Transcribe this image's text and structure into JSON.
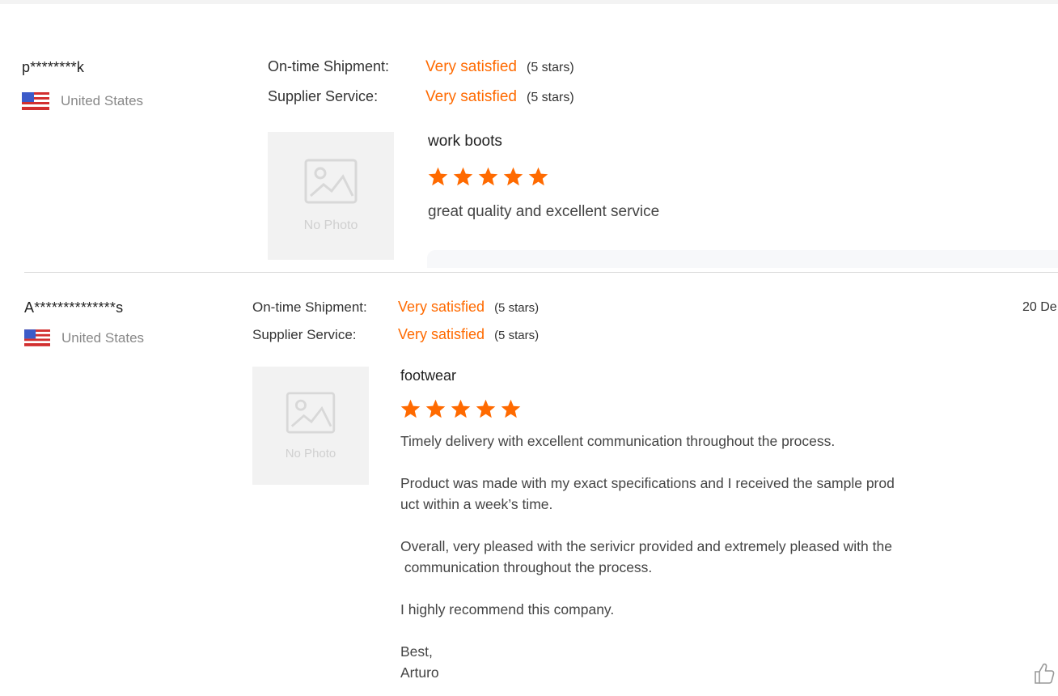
{
  "reviews": [
    {
      "user": "p********k",
      "country": "United States",
      "ratings": [
        {
          "label": "On-time Shipment:",
          "value": "Very satisfied",
          "stars": "(5 stars)"
        },
        {
          "label": "Supplier Service:",
          "value": "Very satisfied",
          "stars": "(5 stars)"
        }
      ],
      "no_photo": "No Photo",
      "product": "work boots",
      "star_count": 5,
      "comment": [
        "great quality and excellent service"
      ]
    },
    {
      "user": "A**************s",
      "country": "United States",
      "date": "20 De",
      "ratings": [
        {
          "label": "On-time Shipment:",
          "value": "Very satisfied",
          "stars": "(5 stars)"
        },
        {
          "label": "Supplier Service:",
          "value": "Very satisfied",
          "stars": "(5 stars)"
        }
      ],
      "no_photo": "No Photo",
      "product": "footwear",
      "star_count": 5,
      "comment": [
        "Timely delivery with excellent communication throughout the process.",
        "",
        "Product was made with my exact specifications and I received the sample prod",
        "uct within a week’s time.",
        "",
        "Overall, very pleased with the serivicr provided and extremely pleased with the",
        " communication throughout the process.",
        "",
        "I highly recommend this company.",
        "",
        "Best,",
        "Arturo"
      ]
    }
  ],
  "colors": {
    "accent": "#ff6a00",
    "star": "#ff6a00",
    "placeholder": "#f2f2f2"
  },
  "icons": {
    "flag": "us-flag-icon",
    "photo": "image-placeholder-icon",
    "star": "star-icon",
    "like": "thumbs-up-icon"
  }
}
